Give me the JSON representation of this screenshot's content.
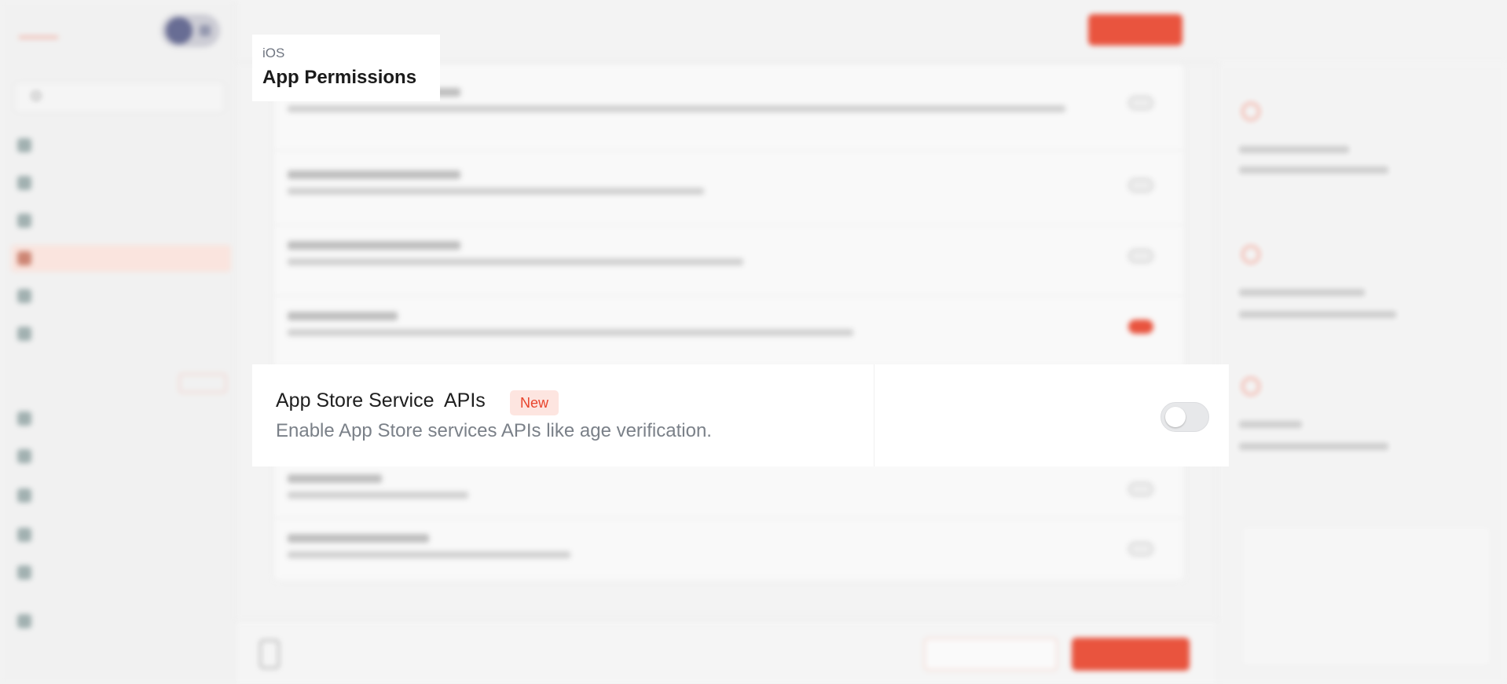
{
  "header": {
    "platform": "iOS",
    "title": "App Permissions"
  },
  "feature": {
    "title": "App Store Service  APIs",
    "badge": "New",
    "description": "Enable App Store services APIs like age verification.",
    "toggle_state": "off"
  },
  "colors": {
    "accent": "#e8432b",
    "badge_bg": "#fde5e0",
    "toggle_off": "#e7e8ea"
  }
}
